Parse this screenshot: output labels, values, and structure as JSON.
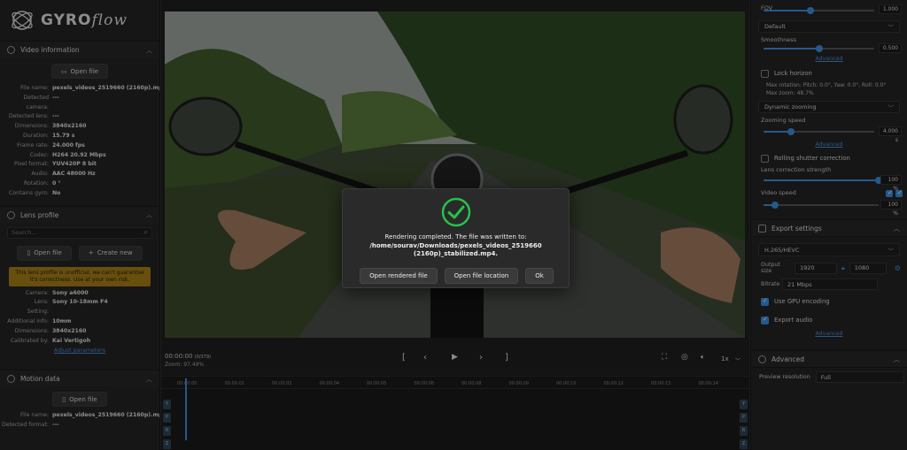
{
  "app": {
    "logo_left": "GYRO",
    "logo_right": "flow"
  },
  "video_info": {
    "title": "Video information",
    "open_file": "Open file",
    "rows": [
      {
        "k": "File name:",
        "v": "pexels_videos_2519660 (2160p).mp4"
      },
      {
        "k": "Detected camera:",
        "v": "---"
      },
      {
        "k": "Detected lens:",
        "v": "---"
      },
      {
        "k": "Dimensions:",
        "v": "3840x2160"
      },
      {
        "k": "Duration:",
        "v": "15.79 s"
      },
      {
        "k": "Frame rate:",
        "v": "24.000 fps"
      },
      {
        "k": "Codec:",
        "v": "H264 20.92 Mbps"
      },
      {
        "k": "Pixel format:",
        "v": "YUV420P 8 bit"
      },
      {
        "k": "Audio:",
        "v": "AAC 48000 Hz"
      },
      {
        "k": "Rotation:",
        "v": "0 °"
      },
      {
        "k": "Contains gyro:",
        "v": "No"
      }
    ]
  },
  "lens_profile": {
    "title": "Lens profile",
    "search_placeholder": "Search...",
    "open_file": "Open file",
    "create_new": "Create new",
    "warning": "This lens profile is unofficial, we can't guarantee it's correctness. Use at your own risk.",
    "rows": [
      {
        "k": "Camera:",
        "v": "Sony a6000"
      },
      {
        "k": "Lens:",
        "v": "Sony 10-18mm F4"
      },
      {
        "k": "Setting:",
        "v": ""
      },
      {
        "k": "Additional info:",
        "v": "10mm"
      },
      {
        "k": "Dimensions:",
        "v": "3840x2160"
      },
      {
        "k": "Calibrated by:",
        "v": "Kai Vertigoh"
      }
    ],
    "adjust": "Adjust parameters"
  },
  "motion_data": {
    "title": "Motion data",
    "open_file": "Open file",
    "rows": [
      {
        "k": "File name:",
        "v": "pexels_videos_2519660 (2160p).mp4"
      },
      {
        "k": "Detected format:",
        "v": "---"
      }
    ]
  },
  "player": {
    "time": "00:00:00",
    "frame": "(0/379)",
    "zoom": "Zoom: 97.49%",
    "speed": "1x",
    "ticks": [
      "00:00:00",
      "00:00:01",
      "00:00:02",
      "00:00:04",
      "00:00:05",
      "00:00:06",
      "00:00:08",
      "00:00:09",
      "00:00:10",
      "00:00:12",
      "00:00:13",
      "00:00:14"
    ],
    "tracks": [
      "Y",
      "P",
      "R",
      "Z"
    ]
  },
  "modal": {
    "line1": "Rendering completed. The file was written to:",
    "line2": "/home/sourav/Downloads/pexels_videos_2519660",
    "line3": "(2160p)_stabilized.mp4.",
    "btn_open": "Open rendered file",
    "btn_location": "Open file location",
    "btn_ok": "Ok"
  },
  "right": {
    "fov_label": "FOV",
    "fov_value": "1.000",
    "fov_level": 0.42,
    "method": "Default",
    "smoothness_label": "Smoothness",
    "smoothness_value": "0.500",
    "smoothness_level": 0.5,
    "advanced": "Advanced",
    "lock_horizon": "Lock horizon",
    "max_rotation_line": "Max rotation: Pitch: 0.0°, Yaw: 0.0°, Roll: 0.0°",
    "max_zoom_line": "Max zoom: 48.7%",
    "zooming_method": "Dynamic zooming",
    "zooming_speed_label": "Zooming speed",
    "zooming_speed_value": "4.000 s",
    "zooming_speed_level": 0.25,
    "rolling_shutter": "Rolling shutter correction",
    "lens_strength_label": "Lens correction strength",
    "lens_strength_value": "100 %",
    "lens_strength_level": 1.0,
    "video_speed_label": "Video speed",
    "video_speed_value": "100 %",
    "video_speed_level": 0.1,
    "export_title": "Export settings",
    "codec": "H.265/HEVC",
    "output_size_label": "Output size",
    "width": "1920",
    "height": "1080",
    "bitrate_label": "Bitrate",
    "bitrate_value": "21 Mbps",
    "gpu": "Use GPU encoding",
    "export_audio": "Export audio",
    "advanced2": "Advanced",
    "adv_title": "Advanced",
    "preview_label": "Preview resolution",
    "preview_value": "Full"
  }
}
